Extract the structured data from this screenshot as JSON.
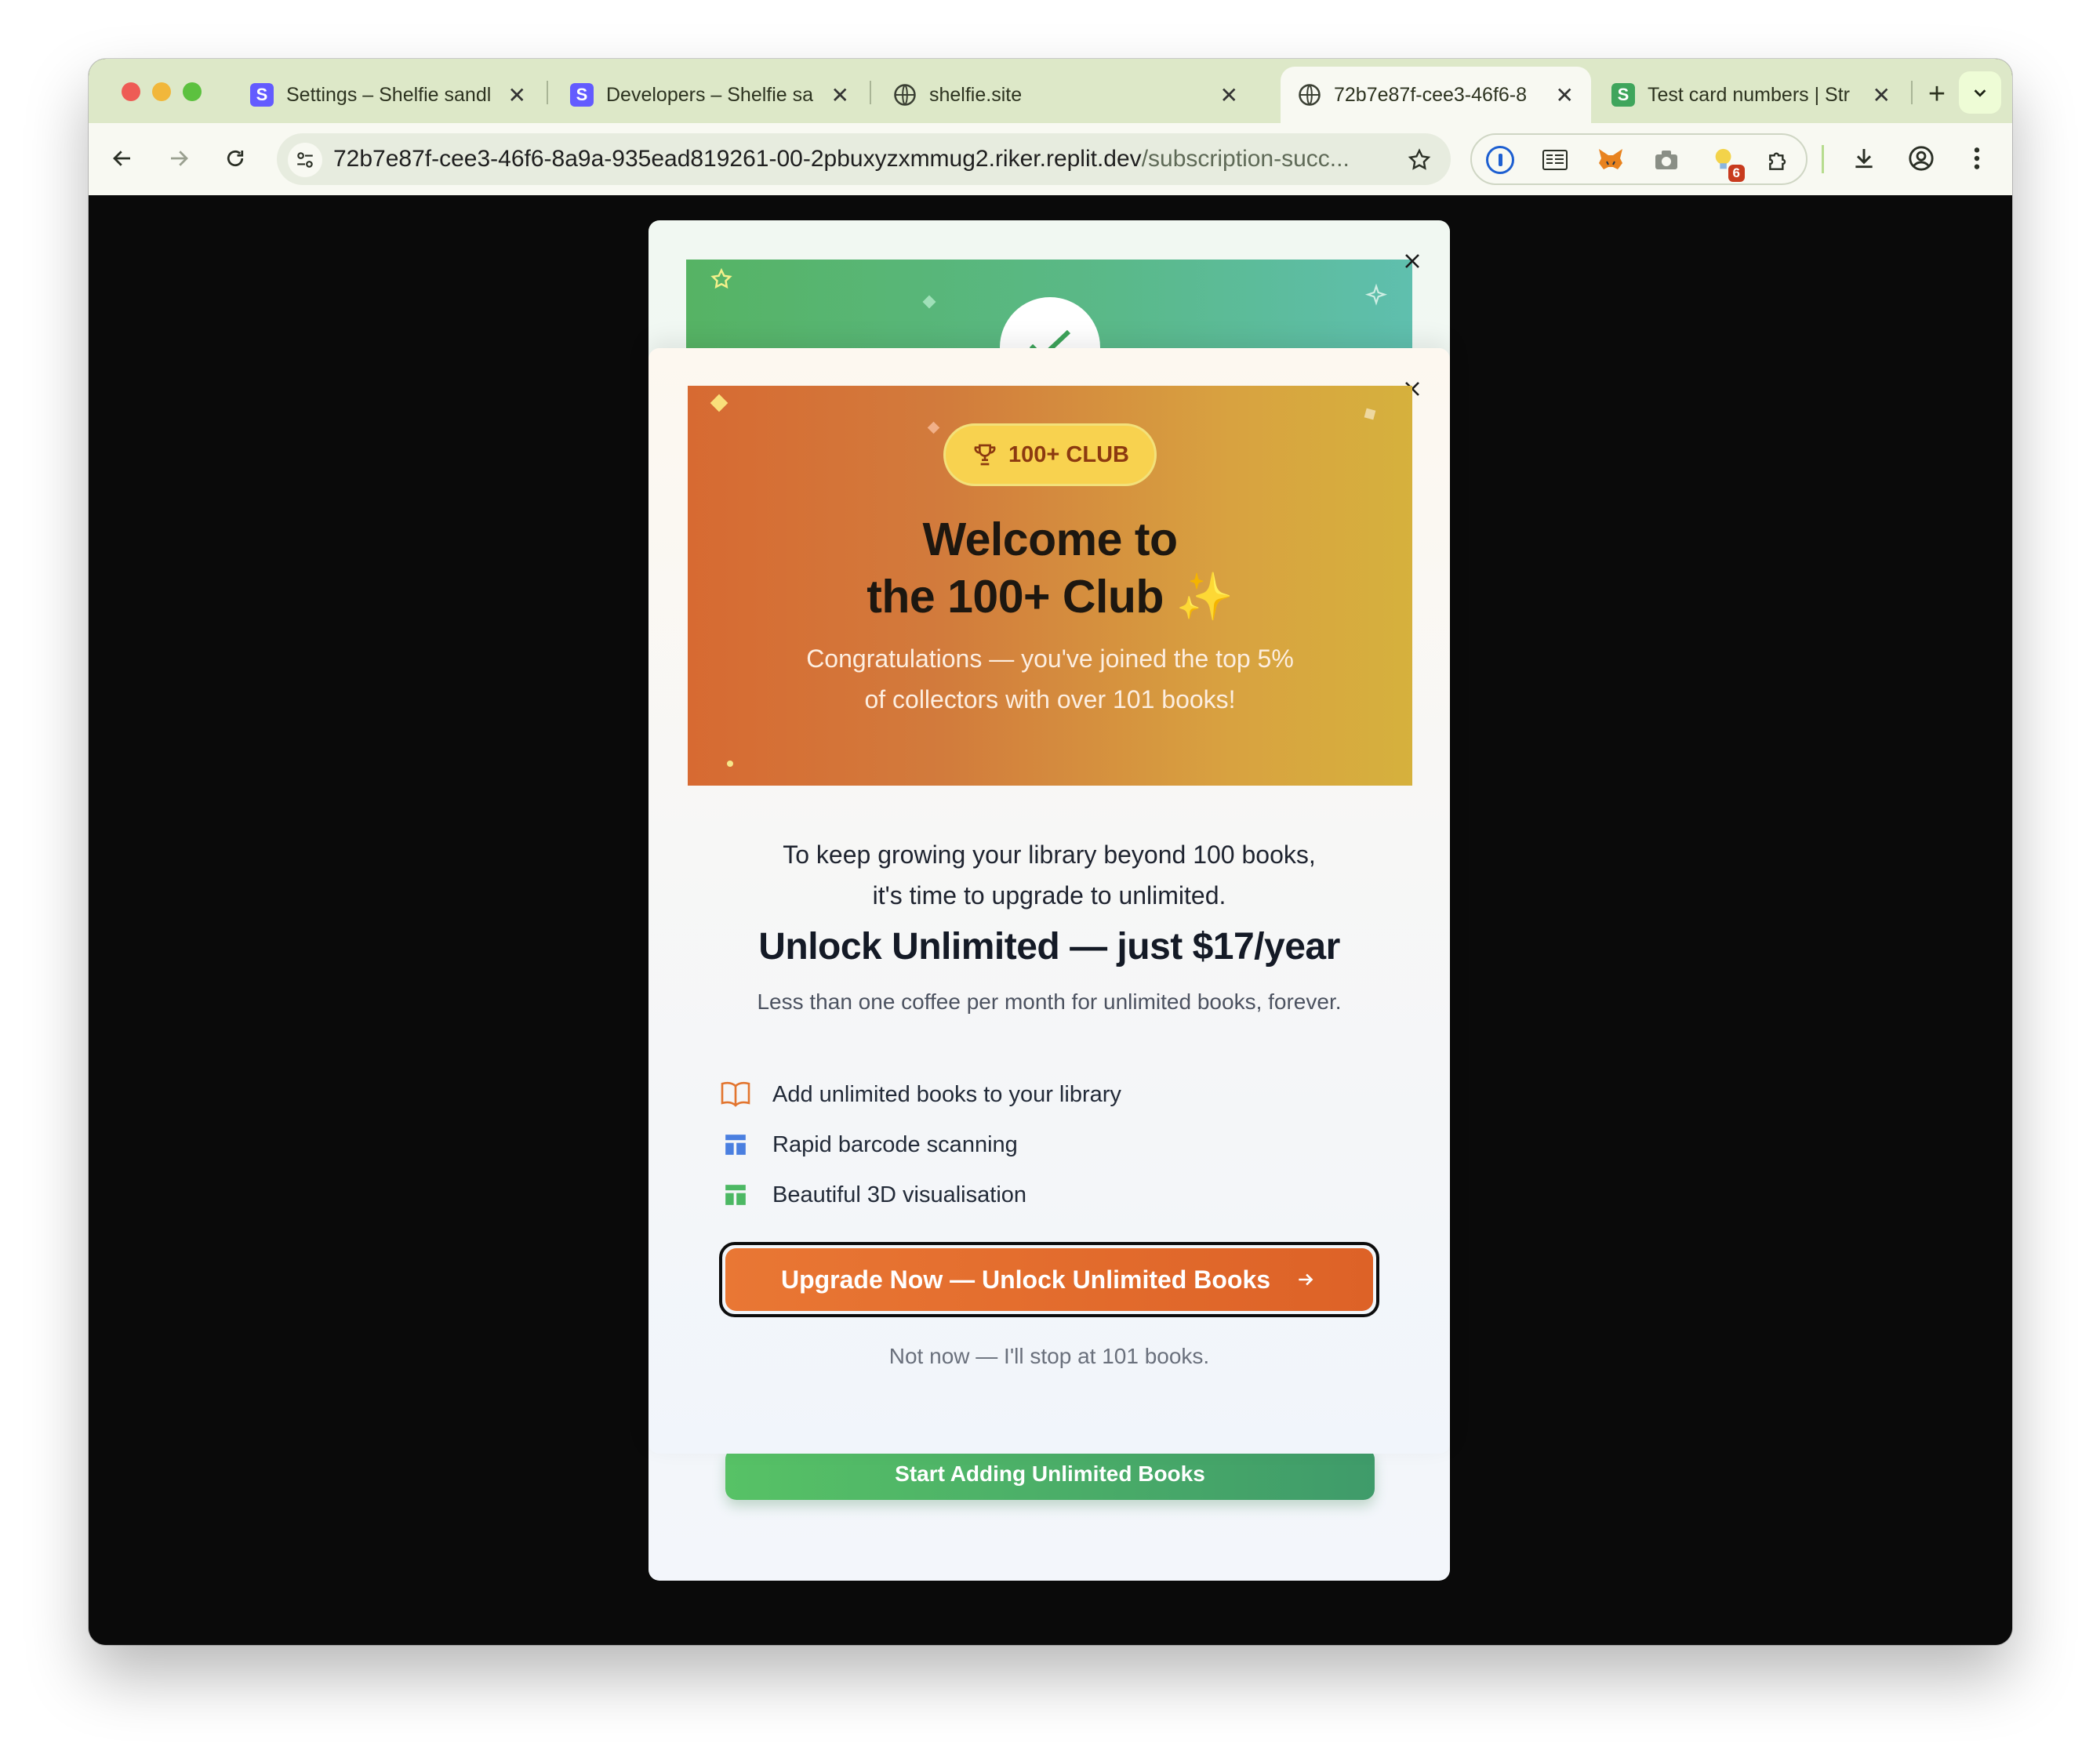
{
  "browser": {
    "tabs": [
      {
        "title": "Settings – Shelfie sandl",
        "favicon": "S",
        "active": false
      },
      {
        "title": "Developers – Shelfie sa",
        "favicon": "S",
        "active": false
      },
      {
        "title": "shelfie.site",
        "favicon": "globe-icon",
        "active": false
      },
      {
        "title": "72b7e87f-cee3-46f6-8",
        "favicon": "globe-icon",
        "active": true
      },
      {
        "title": "Test card numbers | Str",
        "favicon": "S",
        "active": false
      }
    ],
    "url_main": "72b7e87f-cee3-46f6-8a9a-935ead819261-00-2pbuxyzxmmug2.riker.replit.dev",
    "url_path": "/subscription-succ...",
    "extension_badge_count": "6",
    "colors": {
      "tabstrip": "#dde8c8",
      "toolbar": "#f8f9f2"
    }
  },
  "back_modal": {
    "button_label": "Start Adding Unlimited Books",
    "banner_color": "#56b364"
  },
  "modal": {
    "badge": "100+ CLUB",
    "welcome_line1": "Welcome to",
    "welcome_line2": "the 100+ Club ✨",
    "congrats_line1": "Congratulations — you've joined the top 5%",
    "congrats_line2": "of collectors with over 101 books!",
    "intro_line1": "To keep growing your library beyond 100 books,",
    "intro_line2": "it's time to upgrade to unlimited.",
    "headline": "Unlock Unlimited — just $17/year",
    "subheadline": "Less than one coffee per month for unlimited books, forever.",
    "features": [
      {
        "icon": "book-open-icon",
        "label": "Add unlimited books to your library"
      },
      {
        "icon": "layout-icon",
        "label": "Rapid barcode scanning"
      },
      {
        "icon": "layout-icon",
        "label": "Beautiful 3D visualisation"
      }
    ],
    "cta_label": "Upgrade Now — Unlock Unlimited Books",
    "dismiss_label": "Not now — I'll stop at 101 books.",
    "colors": {
      "banner_start": "#d76a32",
      "banner_end": "#d6b13d",
      "cta": "#e97734",
      "badge": "#f8d24f"
    }
  }
}
